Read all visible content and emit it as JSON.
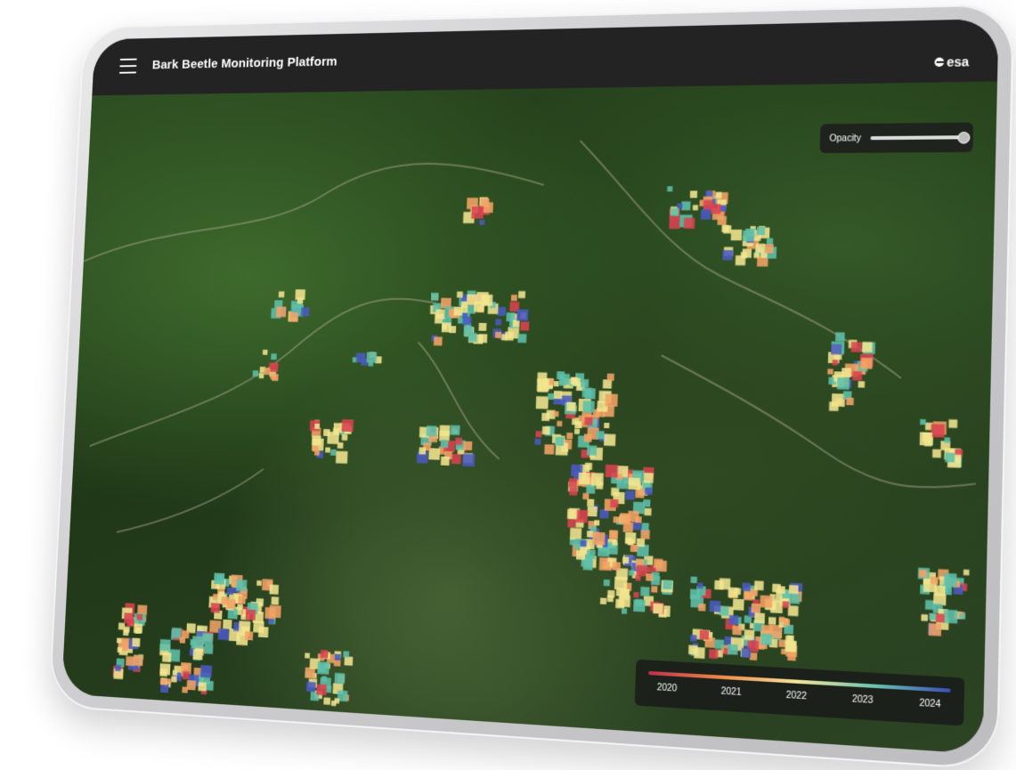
{
  "app": {
    "title": "Bark Beetle Monitoring Platform",
    "logo_text": "esa",
    "menu_icon": "hamburger-menu-icon"
  },
  "opacity_control": {
    "label": "Opacity",
    "value": 1.0
  },
  "legend": {
    "labels": [
      "2020",
      "2021",
      "2022",
      "2023",
      "2024"
    ],
    "colors": [
      "#c0304a",
      "#f08a4b",
      "#f6e49a",
      "#6cc6b0",
      "#3b4fb8"
    ]
  },
  "overlay": {
    "palette": {
      "2020": "#d9434e",
      "2021": "#f2a365",
      "2022": "#f1e58f",
      "2023": "#5fbfa8",
      "2024": "#4a5ac0"
    }
  }
}
